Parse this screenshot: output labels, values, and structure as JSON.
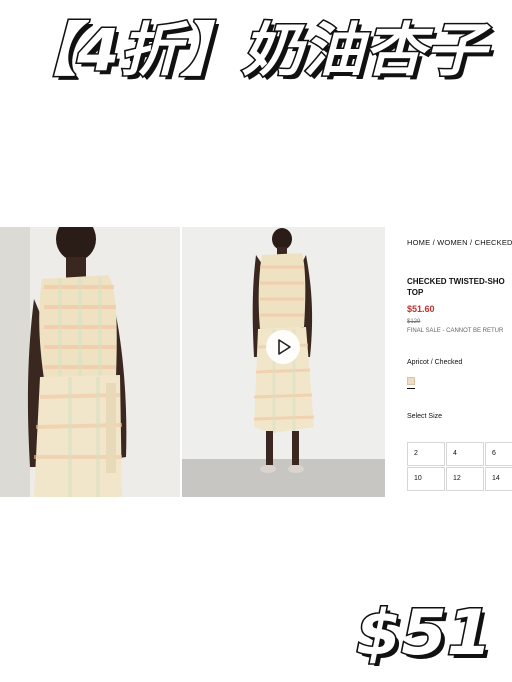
{
  "headline": {
    "text": "【4折】奶油杏子"
  },
  "product": {
    "breadcrumb": "HOME / WOMEN / CHECKED",
    "name_line1": "CHECKED TWISTED-SHO",
    "name_line2": "TOP",
    "price_now": "$51.60",
    "price_was": "$129",
    "final_sale": "FINAL SALE - CANNOT BE RETUR",
    "color_name": "Apricot / Checked",
    "size_label": "Select Size",
    "sizes": [
      "2",
      "4",
      "6",
      "10",
      "12",
      "14"
    ],
    "video_icon": "play-icon",
    "swatch_color": "#f0dcc4"
  },
  "price_tag": {
    "text": "$51"
  },
  "colors": {
    "price_red": "#c0302e",
    "fabric": "#efe3c6"
  }
}
